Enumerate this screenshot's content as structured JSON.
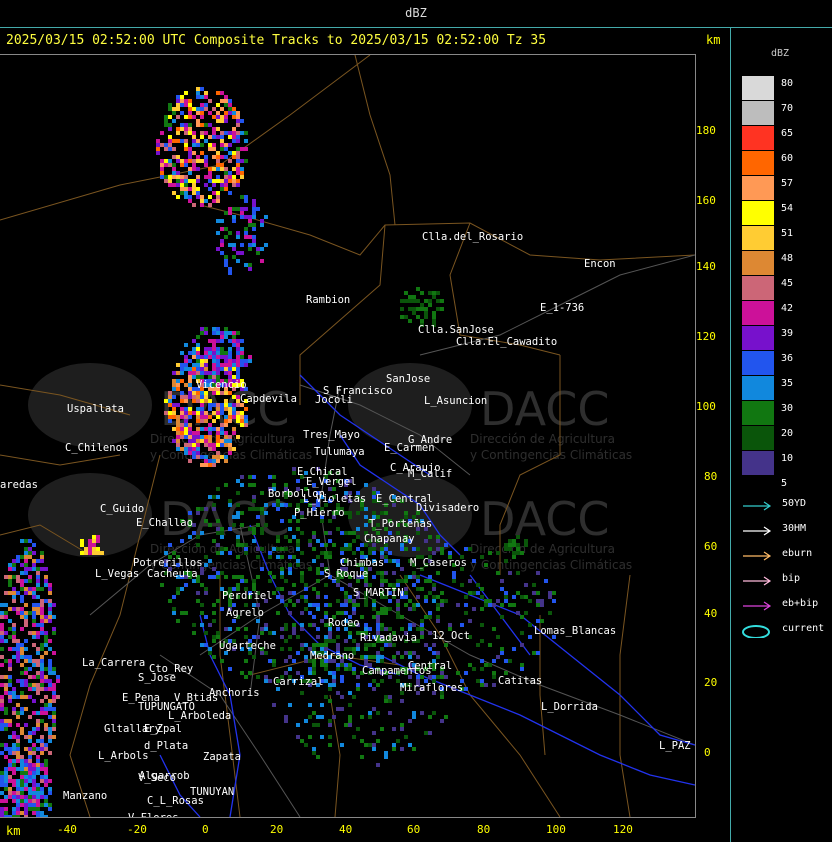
{
  "window_title": "dBZ",
  "header": {
    "text": "2025/03/15 02:52:00 UTC Composite Tracks to 2025/03/15 02:52:00 Tz 35",
    "km_label": "km"
  },
  "axes": {
    "y_ticks": [
      "180",
      "160",
      "140",
      "120",
      "100",
      "80",
      "60",
      "40",
      "20",
      "0"
    ],
    "x_ticks": [
      "-40",
      "-20",
      "0",
      "20",
      "40",
      "60",
      "80",
      "100",
      "120"
    ],
    "km_label": "km"
  },
  "legend": {
    "unit": "dBZ",
    "entries": [
      {
        "label": "80",
        "color": "#d9d9d9"
      },
      {
        "label": "70",
        "color": "#bdbdbd"
      },
      {
        "label": "65",
        "color": "#ff3322"
      },
      {
        "label": "60",
        "color": "#ff6600"
      },
      {
        "label": "57",
        "color": "#ff9955"
      },
      {
        "label": "54",
        "color": "#ffff00"
      },
      {
        "label": "51",
        "color": "#ffcc33"
      },
      {
        "label": "48",
        "color": "#dd8833"
      },
      {
        "label": "45",
        "color": "#cc6677"
      },
      {
        "label": "42",
        "color": "#cc1199"
      },
      {
        "label": "39",
        "color": "#7711cc"
      },
      {
        "label": "36",
        "color": "#2255ee"
      },
      {
        "label": "35",
        "color": "#1188dd"
      },
      {
        "label": "30",
        "color": "#117711"
      },
      {
        "label": "20",
        "color": "#0a550a"
      },
      {
        "label": "10",
        "color": "#44338a"
      },
      {
        "label": "5",
        "color": "#000000"
      }
    ]
  },
  "tracks": [
    {
      "label": "50YD",
      "color": "#33cccc"
    },
    {
      "label": "30HM",
      "color": "#ffffff"
    },
    {
      "label": "eburn",
      "color": "#ffbb66"
    },
    {
      "label": "bip",
      "color": "#ffbbdd"
    },
    {
      "label": "eb+bip",
      "color": "#dd44dd"
    },
    {
      "label": "current",
      "color": "#33dddd"
    }
  ],
  "watermark": {
    "brand": "DACC",
    "line1": "Dirección de Agricultura",
    "line2": "y Contingencias Climáticas"
  },
  "places": [
    "Clla.del_Rosario",
    "Encon",
    "Rambion",
    "E_1-736",
    "Clla.SanJose",
    "Clla.El_Cawadito",
    "Uspallata",
    "Vicencio",
    "Capdevila",
    "S_Francisco",
    "SanJose",
    "L_Asuncion",
    "Jocoli",
    "C_Chilenos",
    "Tres_Mayo",
    "Tulumaya",
    "E_Carmen",
    "G_Andre",
    "E_Chical",
    "E_Vergel",
    "C_Araujo",
    "M_Calif",
    "aredas",
    "Borbollon",
    "L_Violetas",
    "E_Central",
    "Divisadero",
    "C_Guido",
    "E_Challao",
    "P_Hierro",
    "T_Porteñas",
    "Chapanay",
    "Potrerillos",
    "L_Vegas",
    "Cacheuta",
    "Medrano",
    "Agrelo",
    "Perdriel",
    "S_MARTIN",
    "Ugarteche",
    "Rivadavia",
    "La_Carrera",
    "Cto_Rey",
    "S_Jose",
    "Anchoris",
    "Lomas_Blancas",
    "12_Oct",
    "Catitas",
    "E_Pena",
    "TUPUNGATO",
    "V_Btias",
    "L_Arboleda",
    "Carrizal",
    "Miraflores",
    "Central",
    "Gltallary",
    "E_Zpal",
    "L_Dorrida",
    "L_Arbols",
    "d_Plata",
    "Zapata",
    "L_PAZ",
    "Algarrob",
    "V_Seco",
    "TUNUYAN",
    "Manzano",
    "C_L_Rosas",
    "V_Flores",
    "Campamentos",
    "Rodeo",
    "S_Roque",
    "Chimbas",
    "M_Caseros"
  ]
}
